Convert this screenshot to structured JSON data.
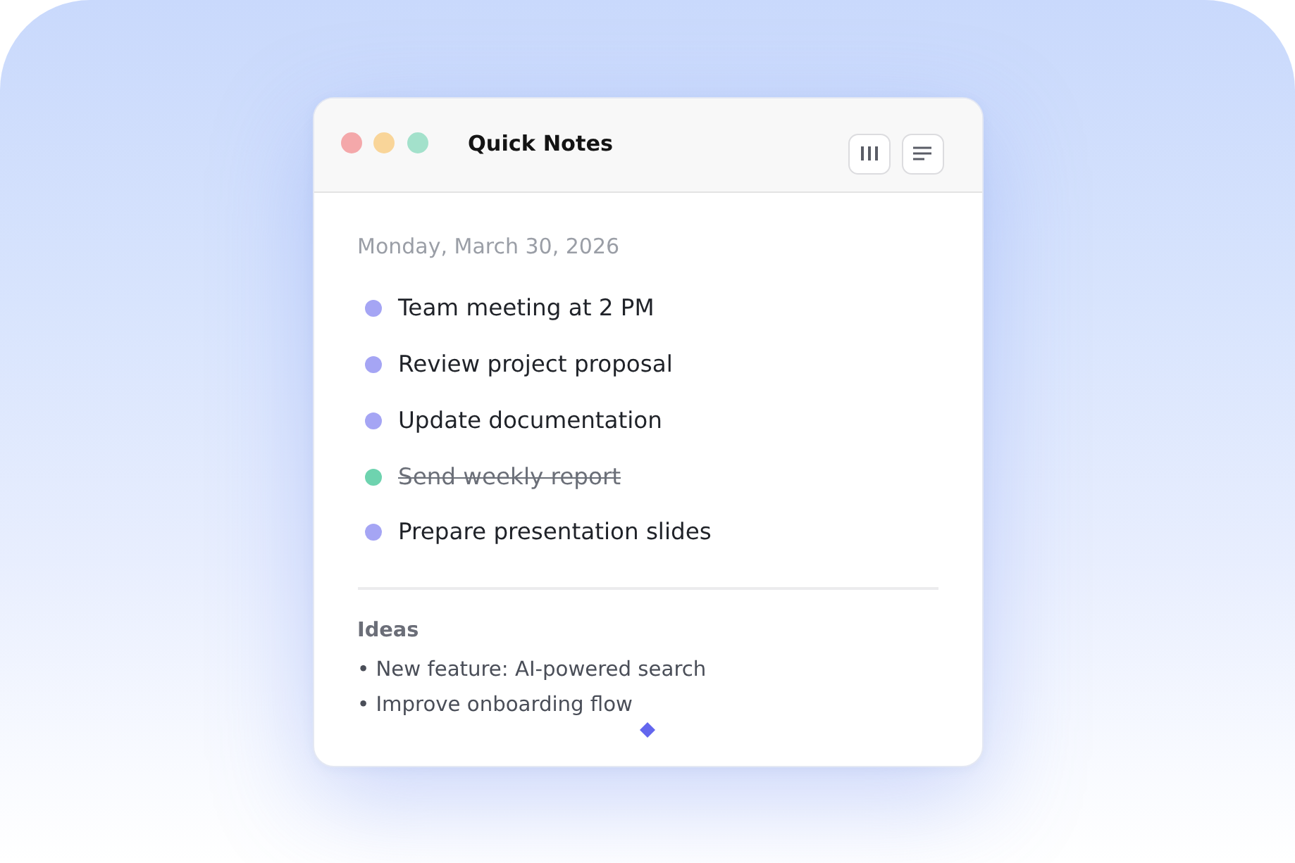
{
  "window": {
    "title": "Quick Notes"
  },
  "date": "Monday, March 30, 2026",
  "tasks": [
    {
      "text": "Team meeting at 2 PM",
      "done": false,
      "color": "#a5a5f4"
    },
    {
      "text": "Review project proposal",
      "done": false,
      "color": "#a5a5f4"
    },
    {
      "text": "Update documentation",
      "done": false,
      "color": "#a5a5f4"
    },
    {
      "text": "Send weekly report",
      "done": true,
      "color": "#6ed3af"
    },
    {
      "text": "Prepare presentation slides",
      "done": false,
      "color": "#a5a5f4"
    }
  ],
  "ideas": {
    "heading": "Ideas",
    "items": [
      "• New feature: AI-powered search",
      "• Improve onboarding flow"
    ]
  }
}
